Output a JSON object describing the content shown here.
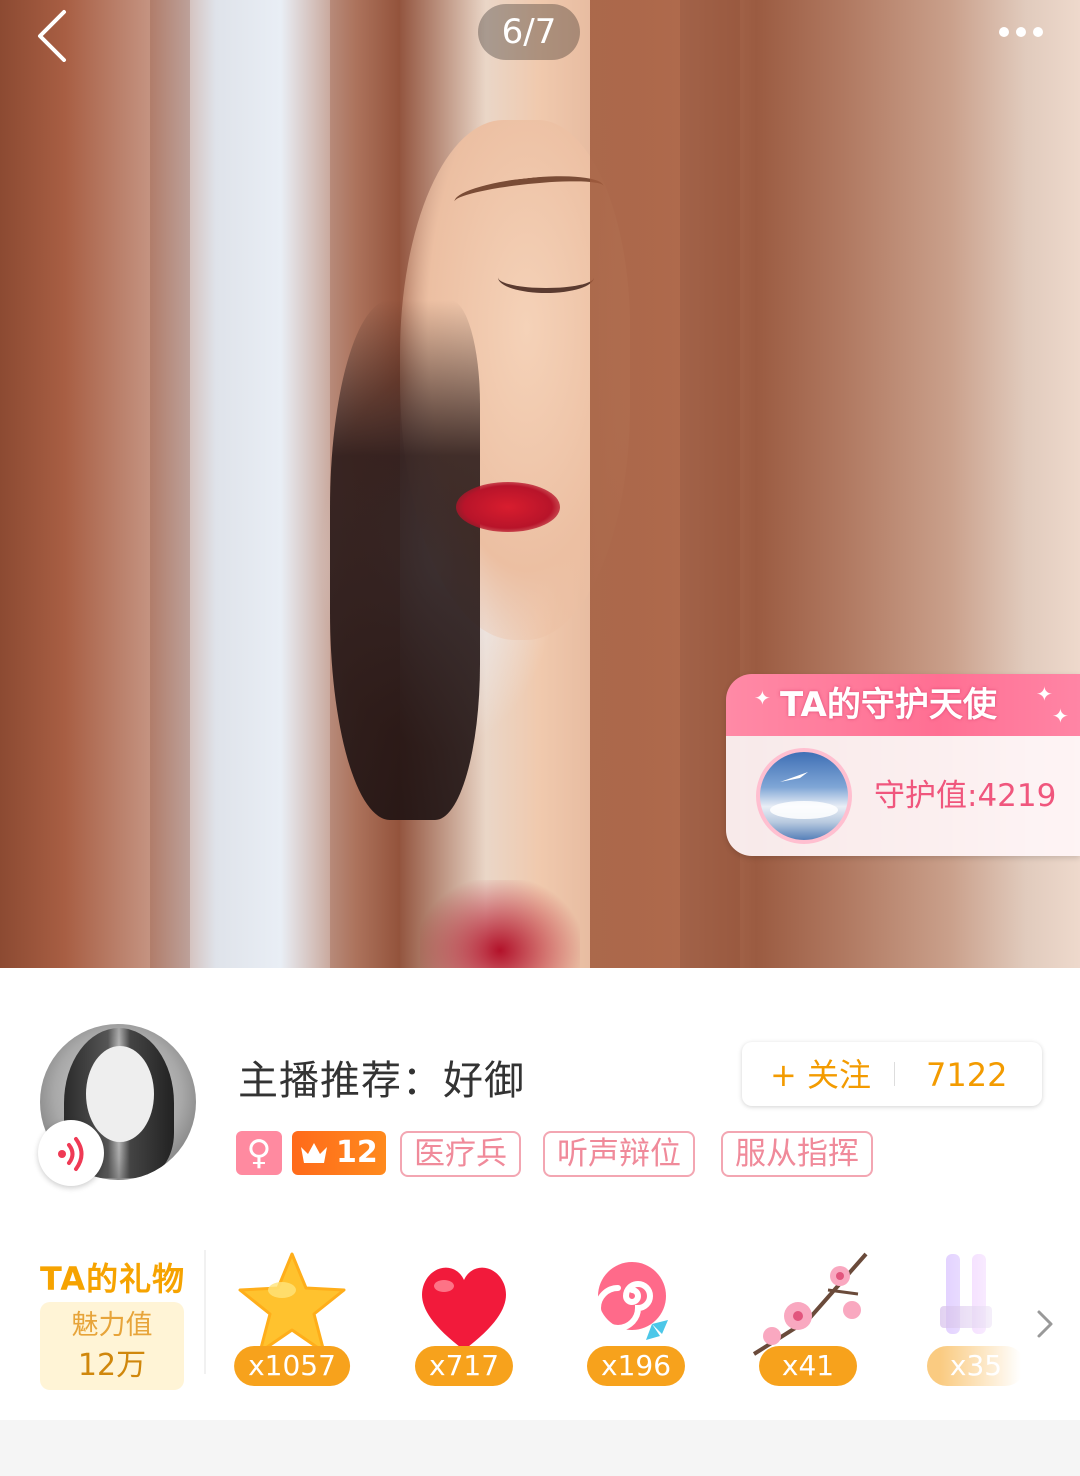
{
  "photo_viewer": {
    "counter": "6/7"
  },
  "guardian": {
    "title": "TA的守护天使",
    "value_text": "守护值:4219"
  },
  "profile": {
    "title": "主播推荐：好御",
    "follow_label": "+ 关注",
    "follow_count": "7122",
    "gender_symbol": "♀",
    "level": "12",
    "tags": [
      "医疗兵",
      "听声辩位",
      "服从指挥"
    ]
  },
  "gifts": {
    "section_title": "TA的礼物",
    "charm_label": "魅力值",
    "charm_value": "12万",
    "items": [
      {
        "icon": "star-icon",
        "count": "x1057"
      },
      {
        "icon": "heart-icon",
        "count": "x717"
      },
      {
        "icon": "lollipop-icon",
        "count": "x196"
      },
      {
        "icon": "cherry-blossom-icon",
        "count": "x41"
      },
      {
        "icon": "glow-stick-icon",
        "count": "x35"
      }
    ]
  },
  "colors": {
    "accent_orange": "#f39b00",
    "pink": "#f0567d",
    "tag_pink": "#f08a9a",
    "gift_badge": "#f7a21c"
  }
}
